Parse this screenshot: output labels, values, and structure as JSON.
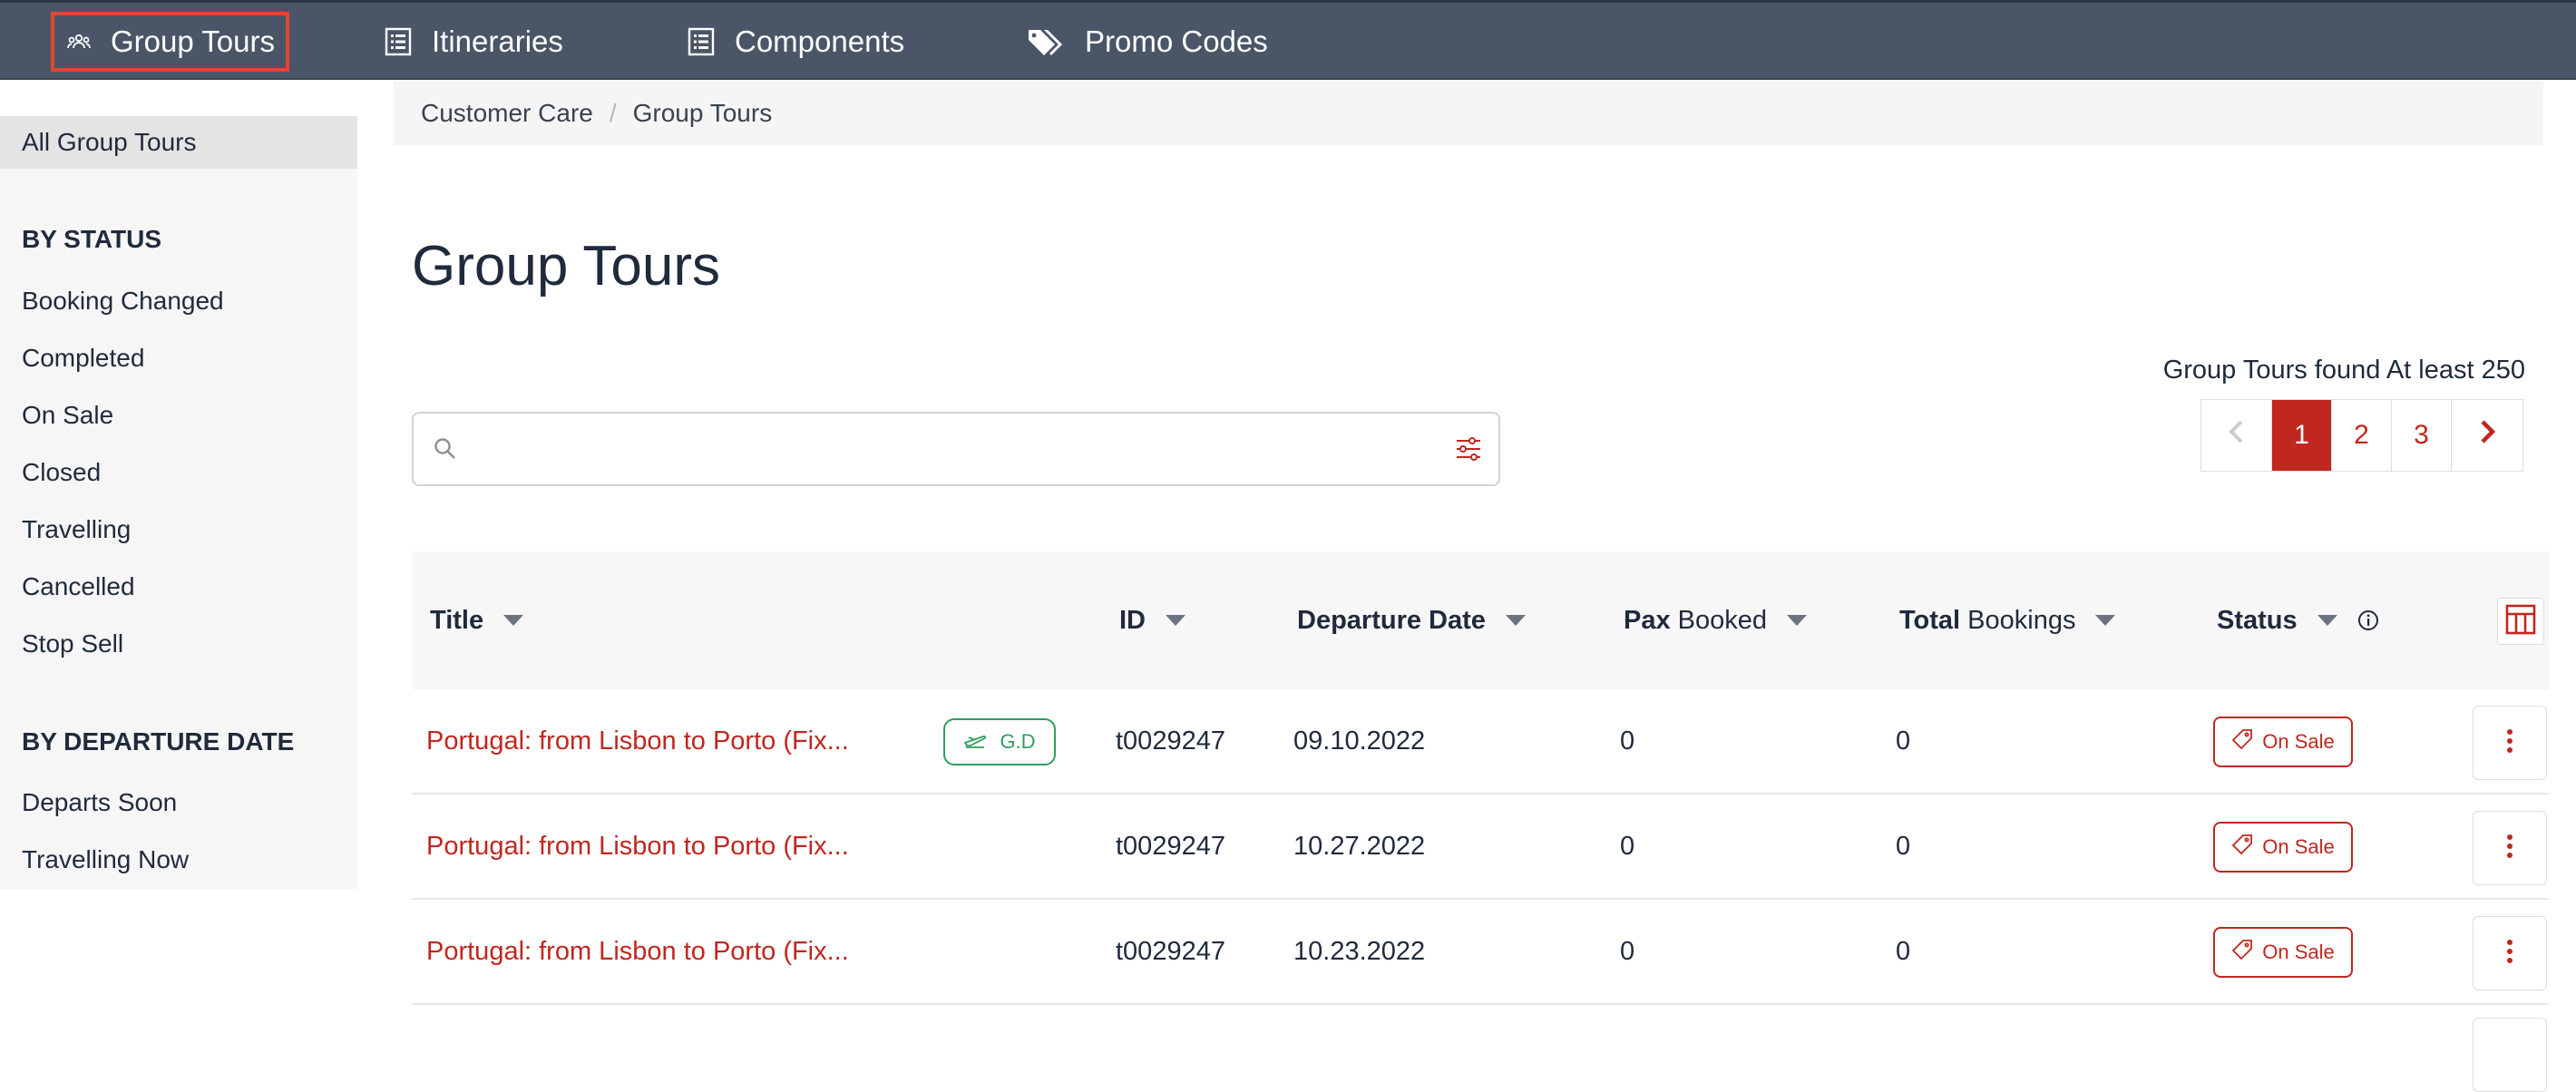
{
  "nav": {
    "items": [
      {
        "label": "Group Tours",
        "icon": "group-icon",
        "active": true
      },
      {
        "label": "Itineraries",
        "icon": "list-icon"
      },
      {
        "label": "Components",
        "icon": "list-icon"
      },
      {
        "label": "Promo Codes",
        "icon": "tags-icon"
      }
    ]
  },
  "sidebar": {
    "all_label": "All Group Tours",
    "status_heading": "BY STATUS",
    "status_items": [
      "Booking Changed",
      "Completed",
      "On Sale",
      "Closed",
      "Travelling",
      "Cancelled",
      "Stop Sell"
    ],
    "departure_heading": "BY DEPARTURE DATE",
    "departure_items": [
      "Departs Soon",
      "Travelling Now"
    ]
  },
  "breadcrumb": [
    "Customer Care",
    "Group Tours"
  ],
  "page_title": "Group Tours",
  "search": {
    "value": "",
    "placeholder": ""
  },
  "results": {
    "found_text": "Group Tours found At least 250"
  },
  "pagination": {
    "pages": [
      "1",
      "2",
      "3"
    ],
    "current": "1"
  },
  "table": {
    "columns": {
      "title": "Title",
      "id": "ID",
      "departure_date": "Departure Date",
      "pax_bold": "Pax",
      "pax_rest": " Booked",
      "total_bold": "Total",
      "total_rest": " Bookings",
      "status": "Status"
    },
    "rows": [
      {
        "title": "Portugal: from Lisbon to Porto (Fix...",
        "badge": "G.D",
        "id": "t0029247",
        "departure": "09.10.2022",
        "pax": "0",
        "bookings": "0",
        "status": "On Sale"
      },
      {
        "title": "Portugal: from Lisbon to Porto (Fix...",
        "badge": "",
        "id": "t0029247",
        "departure": "10.27.2022",
        "pax": "0",
        "bookings": "0",
        "status": "On Sale"
      },
      {
        "title": "Portugal: from Lisbon to Porto (Fix...",
        "badge": "",
        "id": "t0029247",
        "departure": "10.23.2022",
        "pax": "0",
        "bookings": "0",
        "status": "On Sale"
      }
    ]
  },
  "colors": {
    "nav_bg": "#4a5567",
    "accent": "#c0271e",
    "green": "#2e9e5e",
    "active_outline": "#e0472f"
  }
}
